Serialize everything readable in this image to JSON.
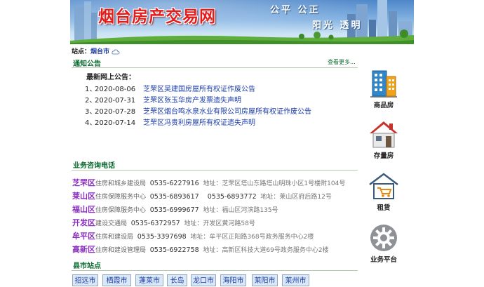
{
  "banner": {
    "title": "烟台房产交易网",
    "slogan_top": "公平  公正",
    "slogan_bottom": "阳光  透明"
  },
  "site": {
    "label": "站点：",
    "value": "烟台市"
  },
  "notice": {
    "section_title": "通知公告",
    "more_link": "查看更多...",
    "latest_label": "最新网上公告：",
    "items": [
      {
        "num": "1、",
        "date": "2020-08-06",
        "title": "芝罘区吴建国房屋所有权证作废公告"
      },
      {
        "num": "2、",
        "date": "2020-07-31",
        "title": "芝罘区张玉华房产发票遗失声明"
      },
      {
        "num": "3、",
        "date": "2020-07-28",
        "title": "芝罘区烟台鸣水泉水业有限公司房屋所有权证作废公告"
      },
      {
        "num": "4、",
        "date": "2020-07-14",
        "title": "芝罘区冯贵利房屋所有权证遗失声明"
      }
    ]
  },
  "contacts": {
    "section_title": "业务咨询电话",
    "rows": [
      {
        "district": "芝罘区",
        "dept": "住房和城乡建设局",
        "phone": "0535-6227916",
        "addr_label": "地址：",
        "addr": "芝罘区塔山东路塔山明珠小区1号楼附104号"
      },
      {
        "district": "莱山区",
        "dept": "住房保障服务中心",
        "phone": "0535-6893617    0535-6893772",
        "addr_label": "地址：",
        "addr": "莱山区府后路12号"
      },
      {
        "district": "福山区",
        "dept": "住房保障服务中心",
        "phone": "0535-6999677",
        "addr_label": "地址：",
        "addr": "福山区河滨路135号"
      },
      {
        "district": "开发区",
        "dept": "建设交通局",
        "phone": "0535-6372957",
        "addr_label": "地址：",
        "addr": "开发区黄河路58号"
      },
      {
        "district": "牟平区",
        "dept": "住房和建设局",
        "phone": "0535-3397698",
        "addr_label": "地址：",
        "addr": "牟平区正阳路368号政务服务中心2楼"
      },
      {
        "district": "高新区",
        "dept": "住房和建设管理局",
        "phone": "0535-6922758",
        "addr_label": "地址：",
        "addr": "高新区科技大道69号政务服务中心2楼"
      }
    ]
  },
  "county": {
    "section_title": "县市站点",
    "buttons": [
      "招远市",
      "栖霞市",
      "蓬莱市",
      "长岛",
      "龙口市",
      "海阳市",
      "莱阳市",
      "莱州市"
    ]
  },
  "nav": {
    "items": [
      {
        "label": "商品房",
        "icon": "building-icon"
      },
      {
        "label": "存量房",
        "icon": "house-icon"
      },
      {
        "label": "租赁",
        "icon": "rent-house-cart-icon"
      },
      {
        "label": "业务平台",
        "icon": "gear-icon"
      }
    ]
  },
  "colors": {
    "section_green": "#0a6b2e",
    "link_blue": "#1a3caa",
    "district_purple": "#8a2ec0",
    "title_red": "#e51c1c"
  }
}
